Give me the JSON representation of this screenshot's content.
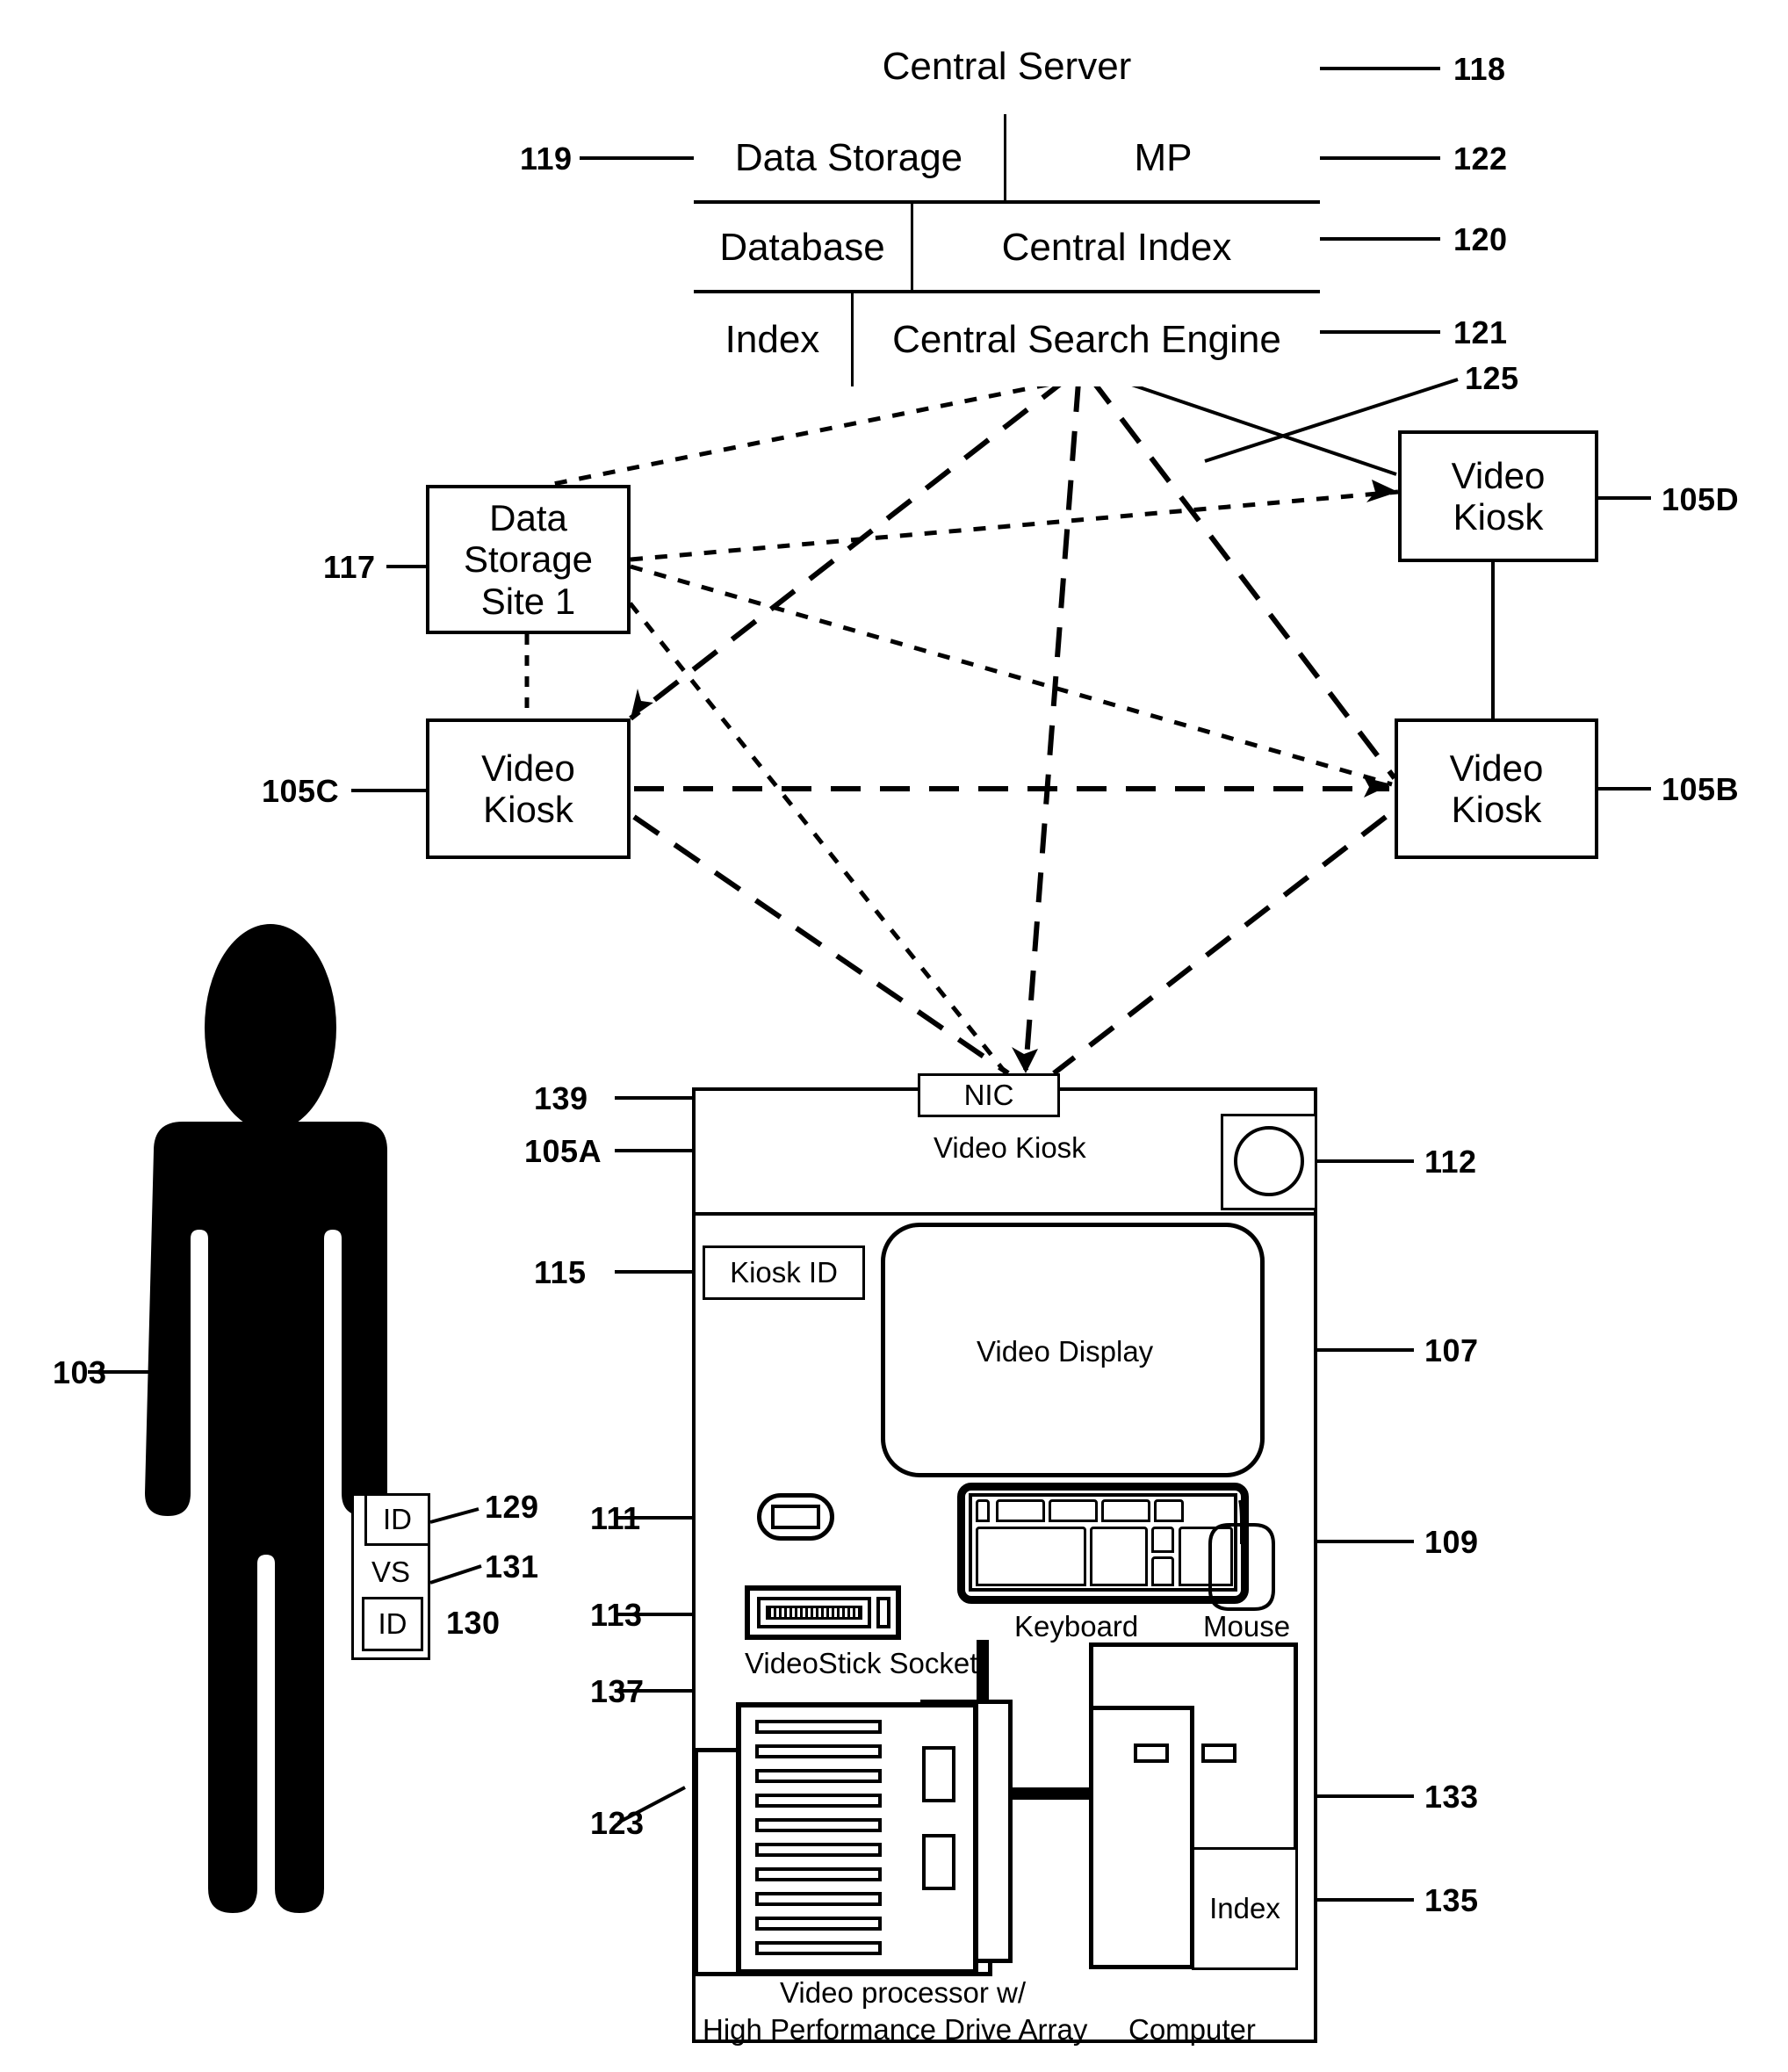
{
  "figure": {
    "kind": "patent-network-diagram",
    "central_server": {
      "title": "Central Server",
      "title_ref": "118",
      "rows": [
        {
          "cells": [
            {
              "label": "Data Storage",
              "ref": "119",
              "ref_side": "left"
            },
            {
              "label": "MP",
              "ref": "122",
              "ref_side": "right"
            }
          ]
        },
        {
          "cells": [
            {
              "label": "Database",
              "ref": "",
              "ref_side": ""
            },
            {
              "label": "Central Index",
              "ref": "120",
              "ref_side": "right"
            }
          ]
        },
        {
          "cells": [
            {
              "label": "Index",
              "ref": "",
              "ref_side": ""
            },
            {
              "label": "Central Search Engine",
              "ref": "121",
              "ref_side": "right"
            }
          ]
        }
      ]
    },
    "network": {
      "link_ref": "125",
      "nodes": [
        {
          "id": "data-storage-site-1",
          "label": "Data Storage Site 1",
          "ref": "117",
          "ref_side": "left"
        },
        {
          "id": "video-kiosk-d",
          "label": "Video Kiosk",
          "ref": "105D",
          "ref_side": "right"
        },
        {
          "id": "video-kiosk-c",
          "label": "Video Kiosk",
          "ref": "105C",
          "ref_side": "left"
        },
        {
          "id": "video-kiosk-b",
          "label": "Video Kiosk",
          "ref": "105B",
          "ref_side": "right"
        }
      ]
    },
    "user": {
      "ref": "103",
      "badge": {
        "top_label": "ID",
        "top_ref": "129",
        "middle_label": "VS",
        "middle_ref": "131",
        "bottom_label": "ID",
        "bottom_ref": "130"
      }
    },
    "kiosk_detail": {
      "nic_label": "NIC",
      "nic_ref": "139",
      "title": "Video Kiosk",
      "title_ref": "105A",
      "camera_ref": "112",
      "kiosk_id_label": "Kiosk ID",
      "kiosk_id_ref": "115",
      "video_display_label": "Video Display",
      "video_display_ref": "107",
      "card_slot_ref": "111",
      "videostick_socket_label": "VideoStick Socket",
      "videostick_socket_ref": "113",
      "socket_cable_ref": "137",
      "keyboard_label": "Keyboard",
      "keyboard_ref": "109",
      "mouse_label": "Mouse",
      "processor_label_line1": "Video processor w/",
      "processor_label_line2": "High Performance Drive Array",
      "processor_ref": "123",
      "computer_label": "Computer",
      "computer_ref": "133",
      "index_label": "Index",
      "index_ref": "135"
    }
  },
  "colors": {
    "ink": "#000000",
    "paper": "#ffffff"
  }
}
